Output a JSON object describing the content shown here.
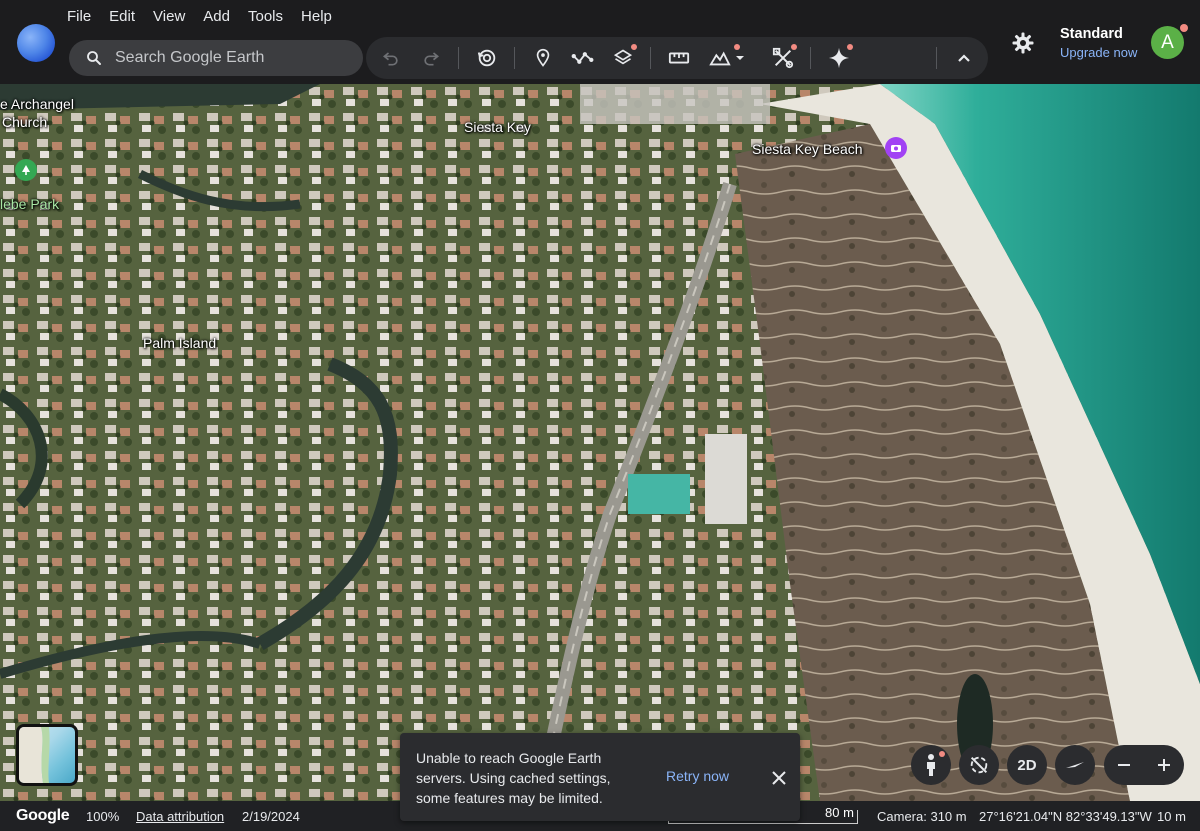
{
  "menu": [
    "File",
    "Edit",
    "View",
    "Add",
    "Tools",
    "Help"
  ],
  "search": {
    "placeholder": "Search Google Earth"
  },
  "toolbar": {
    "icons": [
      "search-icon",
      "undo-icon",
      "redo-icon",
      "historical-imagery-icon",
      "placemark-icon",
      "path-icon",
      "layers-icon",
      "measure-icon",
      "elevation-icon",
      "tools-icon",
      "gemini-icon",
      "chevron-up-icon"
    ]
  },
  "account": {
    "plan": "Standard",
    "upgrade": "Upgrade now",
    "avatar_letter": "A"
  },
  "map": {
    "labels": {
      "archangel": "e Archangel",
      "church": "Church",
      "siesta_key": "Siesta Key",
      "siesta_key_beach": "Siesta Key Beach",
      "glebe_park": "lebe Park",
      "palm_island": "Palm Island"
    }
  },
  "controls": {
    "view_mode": "2D"
  },
  "toast": {
    "message": "Unable to reach Google Earth servers. Using cached settings, some features may be limited.",
    "retry": "Retry now"
  },
  "status": {
    "logo": "Google",
    "zoom": "100%",
    "attribution": "Data attribution",
    "date": "2/19/2024",
    "scale": "80 m",
    "camera": "Camera: 310 m",
    "coordinates": "27°16'21.04\"N 82°33'49.13\"W",
    "elevation": "10 m"
  },
  "colors": {
    "accent": "#8ab4f8",
    "avatar": "#5bb047",
    "notification_dot": "#f28b82",
    "ocean": "#2fae9a"
  }
}
